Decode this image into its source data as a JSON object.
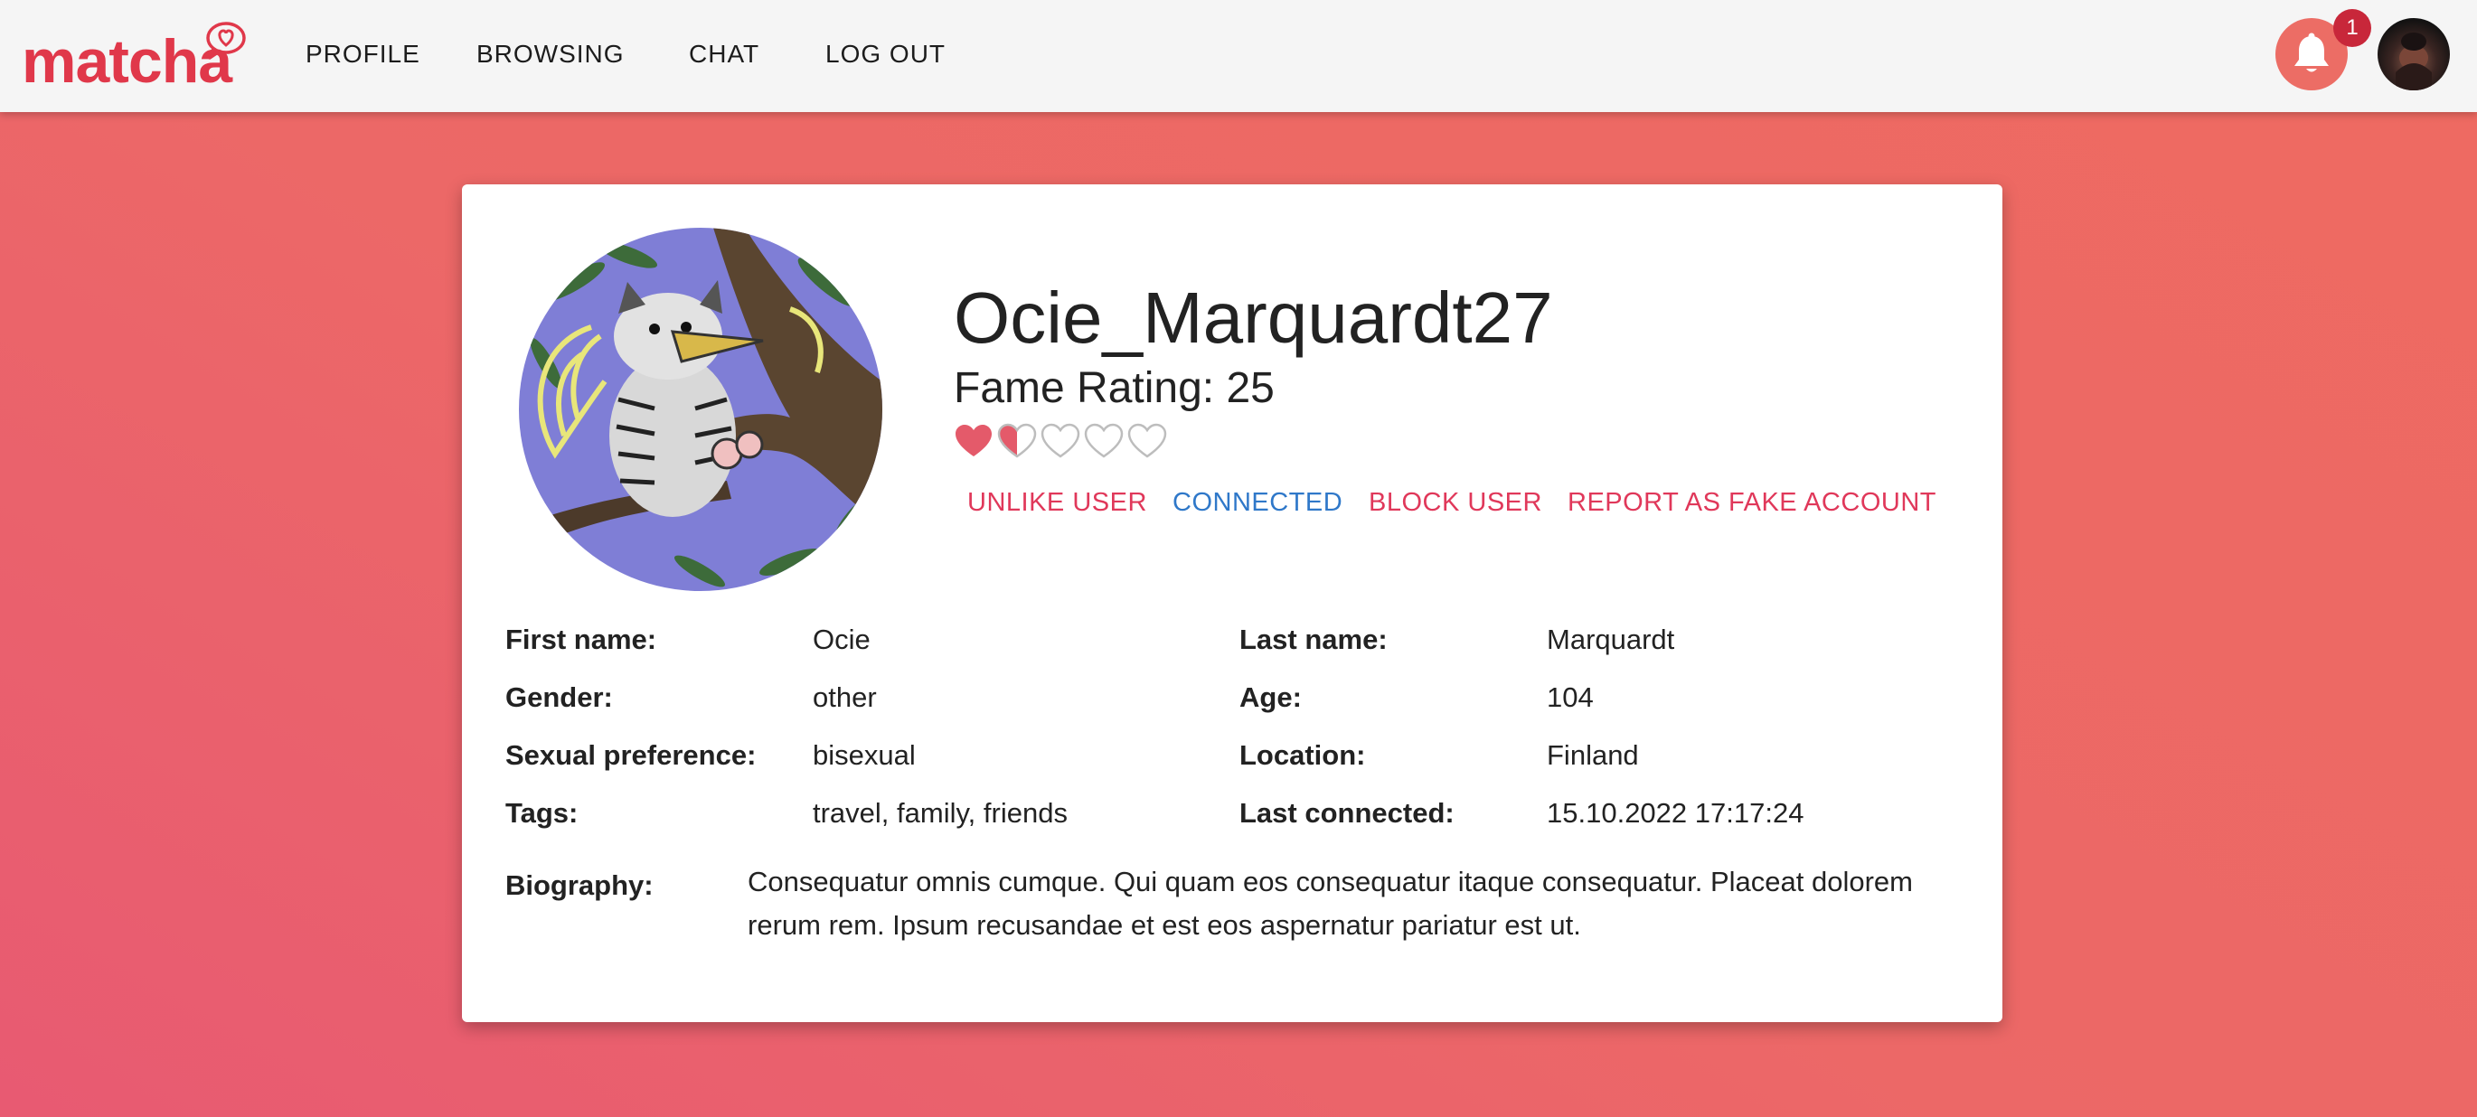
{
  "brand": {
    "logo_text": "matcha",
    "color": "#e0384a"
  },
  "nav": {
    "items": [
      "PROFILE",
      "BROWSING",
      "CHAT",
      "LOG OUT"
    ]
  },
  "notifications": {
    "count": "1",
    "icon": "bell-icon"
  },
  "user_avatar": {
    "icon": "avatar"
  },
  "profile": {
    "username": "Ocie_Marquardt27",
    "fame_rating": "Fame Rating: 25",
    "hearts": {
      "value": 1.5,
      "max": 5,
      "filled_color": "#e45a6a",
      "empty_color": "#bdbdbd"
    },
    "actions": [
      {
        "label": "UNLIKE USER",
        "color": "#e0385a"
      },
      {
        "label": "CONNECTED",
        "color": "#2f78c9"
      },
      {
        "label": "BLOCK USER",
        "color": "#e0385a"
      },
      {
        "label": "REPORT AS FAKE ACCOUNT",
        "color": "#e0385a"
      }
    ],
    "fields": {
      "first_name": {
        "label": "First name:",
        "value": "Ocie"
      },
      "last_name": {
        "label": "Last name:",
        "value": "Marquardt"
      },
      "gender": {
        "label": "Gender:",
        "value": "other"
      },
      "age": {
        "label": "Age:",
        "value": "104"
      },
      "sexual_preference": {
        "label": "Sexual preference:",
        "value": "bisexual"
      },
      "location": {
        "label": "Location:",
        "value": "Finland"
      },
      "tags": {
        "label": "Tags:",
        "value": "travel, family, friends"
      },
      "last_connected": {
        "label": "Last connected:",
        "value": "15.10.2022 17:17:24"
      }
    },
    "biography": {
      "label": "Biography:",
      "text": "Consequatur omnis cumque. Qui quam eos consequatur itaque consequatur. Placeat dolorem rerum rem. Ipsum recusandae et est eos aspernatur pariatur est ut."
    }
  }
}
